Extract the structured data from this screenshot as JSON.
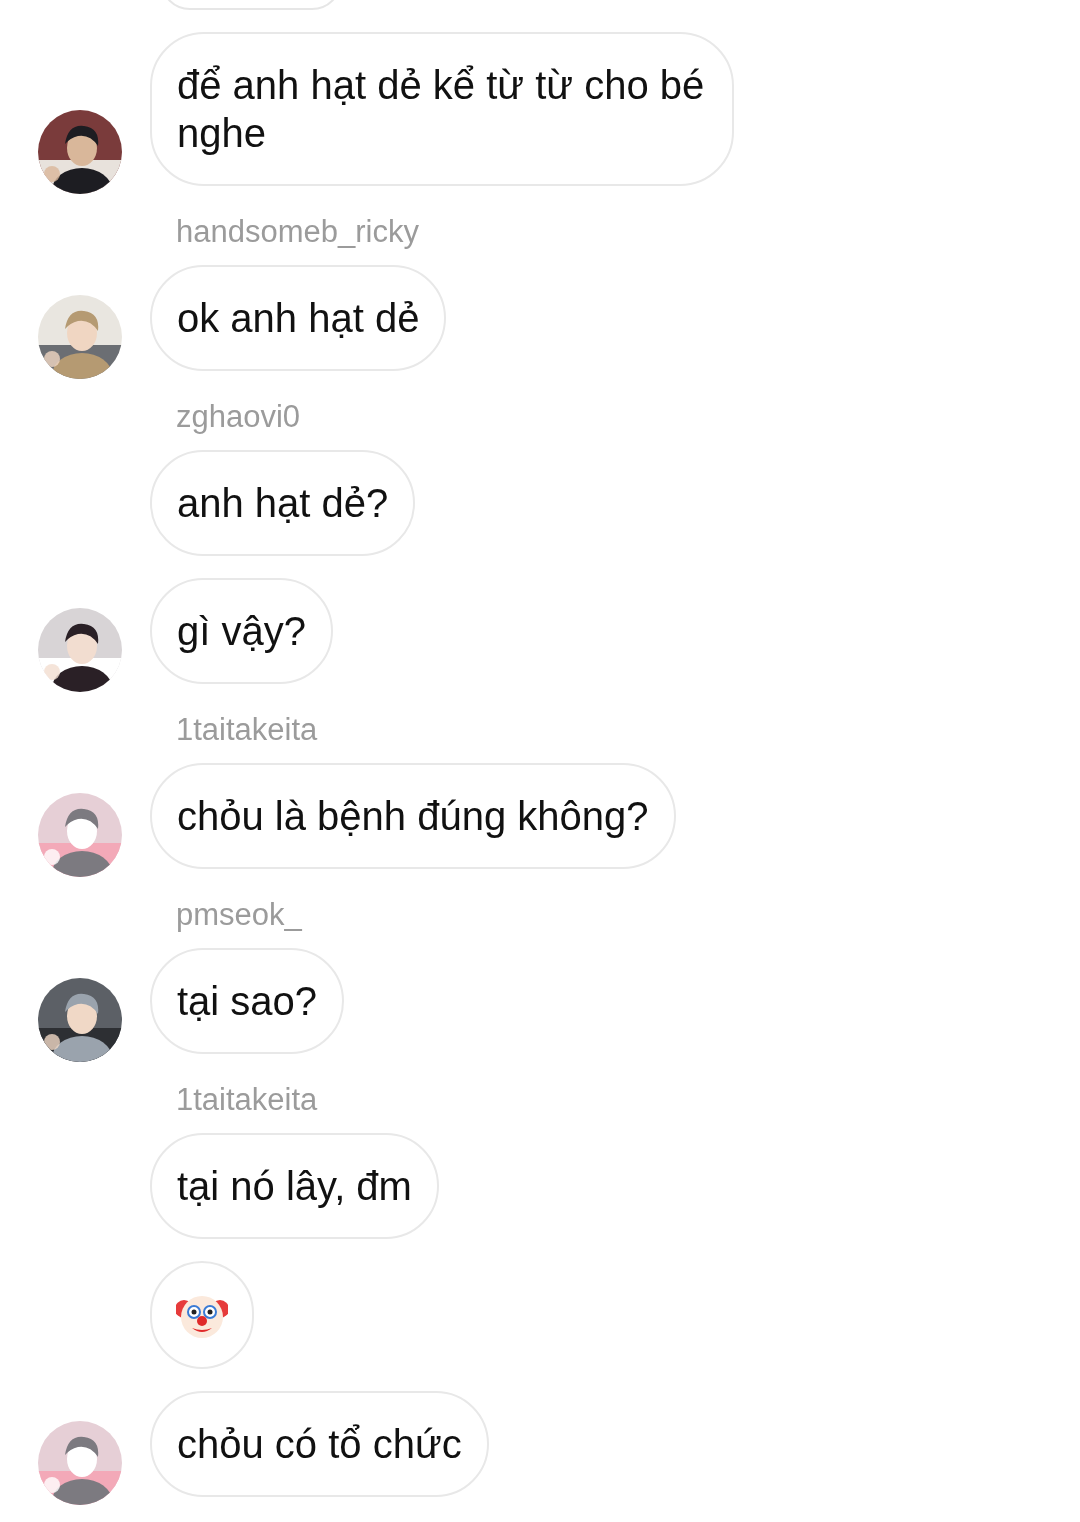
{
  "groups": [
    {
      "messages": [
        {
          "kind": "text",
          "text": "để anh hạt dẻ kể từ từ cho bé nghe"
        }
      ],
      "avatar": {
        "kind": "picture"
      }
    },
    {
      "sender": "handsomeb_ricky",
      "messages": [
        {
          "kind": "text",
          "text": "ok anh hạt dẻ"
        }
      ],
      "avatar": {
        "kind": "picture"
      }
    },
    {
      "sender": "zghaovi0",
      "messages": [
        {
          "kind": "text",
          "text": "anh hạt dẻ?"
        },
        {
          "kind": "text",
          "text": "gì vậy?"
        }
      ],
      "avatar": {
        "kind": "picture"
      }
    },
    {
      "sender": "1taitakeita",
      "messages": [
        {
          "kind": "text",
          "text": "chỏu là bệnh đúng không?"
        }
      ],
      "avatar": {
        "kind": "picture"
      }
    },
    {
      "sender": "pmseok_",
      "messages": [
        {
          "kind": "text",
          "text": "tại sao?"
        }
      ],
      "avatar": {
        "kind": "picture"
      }
    },
    {
      "sender": "1taitakeita",
      "messages": [
        {
          "kind": "text",
          "text": "tại nó lây, đm"
        },
        {
          "kind": "emoji"
        },
        {
          "kind": "text",
          "text": "chỏu có tổ chức"
        }
      ],
      "avatar": {
        "kind": "picture"
      }
    }
  ]
}
